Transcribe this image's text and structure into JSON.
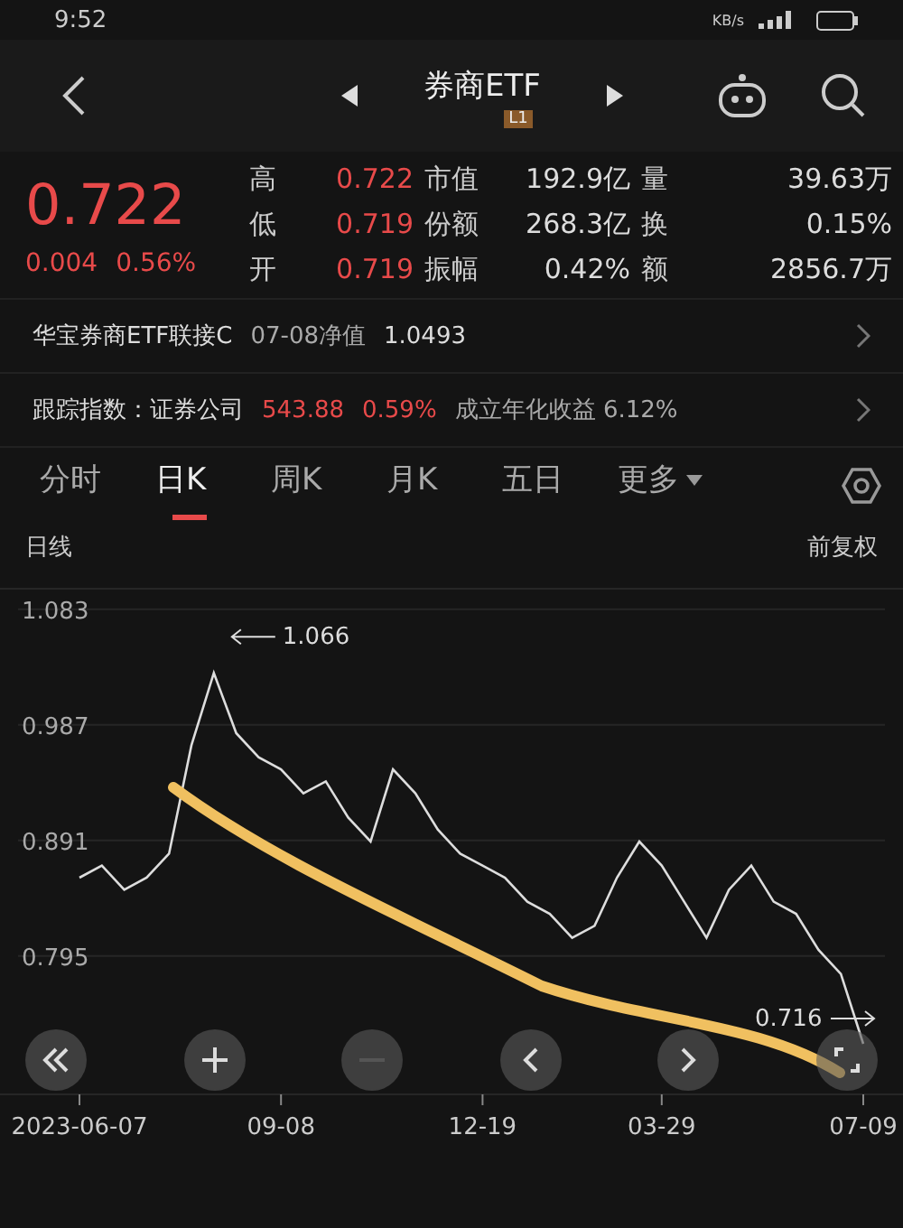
{
  "status_bar": {
    "time": "9:52",
    "network_speed": "KB/s"
  },
  "header": {
    "title": "券商ETF",
    "badge": "L1"
  },
  "quote": {
    "price": "0.722",
    "change": "0.004",
    "change_pct": "0.56%",
    "stats": [
      {
        "label": "高",
        "value": "0.722",
        "color": "#e84a4a"
      },
      {
        "label": "市值",
        "value": "192.9亿",
        "color": "#dddddd"
      },
      {
        "label": "量",
        "value": "39.63万",
        "color": "#dddddd"
      },
      {
        "label": "低",
        "value": "0.719",
        "color": "#e84a4a"
      },
      {
        "label": "份额",
        "value": "268.3亿",
        "color": "#dddddd"
      },
      {
        "label": "换",
        "value": "0.15%",
        "color": "#dddddd"
      },
      {
        "label": "开",
        "value": "0.719",
        "color": "#e84a4a"
      },
      {
        "label": "振幅",
        "value": "0.42%",
        "color": "#dddddd"
      },
      {
        "label": "额",
        "value": "2856.7万",
        "color": "#dddddd"
      }
    ]
  },
  "fund_row": {
    "name": "华宝券商ETF联接C",
    "nav_label": "07-08净值",
    "nav": "1.0493"
  },
  "index_row": {
    "label": "跟踪指数：证券公司",
    "value": "543.88",
    "pct": "0.59%",
    "annual": "成立年化收益 6.12%"
  },
  "tabs": [
    {
      "label": "分时",
      "selected": false,
      "dropdown": false
    },
    {
      "label": "日K",
      "selected": true,
      "dropdown": false
    },
    {
      "label": "周K",
      "selected": false,
      "dropdown": false
    },
    {
      "label": "月K",
      "selected": false,
      "dropdown": false
    },
    {
      "label": "五日",
      "selected": false,
      "dropdown": false
    },
    {
      "label": "更多",
      "selected": false,
      "dropdown": true
    }
  ],
  "chart_header": {
    "left": "日线",
    "right": "前复权"
  },
  "chart": {
    "chart_data": {
      "type": "line",
      "categories": [
        "2023-06-07",
        null,
        null,
        null,
        null,
        null,
        null,
        null,
        null,
        "09-08",
        null,
        null,
        null,
        null,
        null,
        null,
        null,
        null,
        "12-19",
        null,
        null,
        null,
        null,
        null,
        null,
        null,
        "03-29",
        null,
        null,
        null,
        null,
        null,
        null,
        null,
        null,
        "07-09"
      ],
      "series": [
        {
          "color": "#dddddd",
          "values": [
            0.86,
            0.87,
            0.85,
            0.86,
            0.88,
            0.97,
            1.03,
            0.98,
            0.96,
            0.95,
            0.93,
            0.94,
            0.91,
            0.89,
            0.95,
            0.93,
            0.9,
            0.88,
            0.87,
            0.86,
            0.84,
            0.83,
            0.81,
            0.82,
            0.86,
            0.89,
            0.87,
            0.84,
            0.81,
            0.85,
            0.87,
            0.84,
            0.83,
            0.8,
            0.78,
            0.722
          ]
        }
      ],
      "ylim": [
        0.68,
        1.1
      ],
      "yticks": [
        {
          "value": 1.083,
          "label": "1.083"
        },
        {
          "value": 0.987,
          "label": "0.987"
        },
        {
          "value": 0.891,
          "label": "0.891"
        },
        {
          "value": 0.795,
          "label": "0.795"
        }
      ],
      "grid": true,
      "annotations": [
        "1.066",
        "0.716"
      ]
    }
  }
}
